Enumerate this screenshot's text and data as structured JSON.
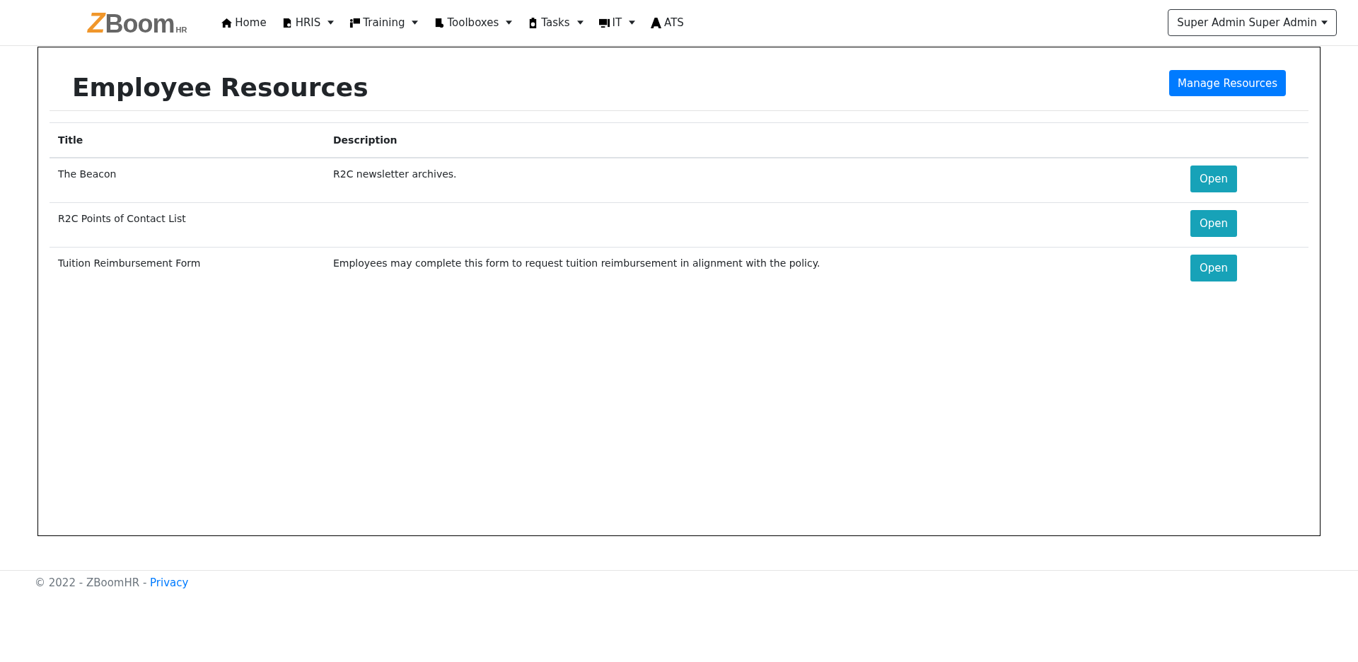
{
  "brand": {
    "mark": "Z",
    "name": "Boom",
    "suffix": "HR"
  },
  "nav": [
    {
      "label": "Home",
      "dropdown": false
    },
    {
      "label": "HRIS",
      "dropdown": true
    },
    {
      "label": "Training",
      "dropdown": true
    },
    {
      "label": "Toolboxes",
      "dropdown": true
    },
    {
      "label": "Tasks",
      "dropdown": true
    },
    {
      "label": "IT",
      "dropdown": true
    },
    {
      "label": "ATS",
      "dropdown": false
    }
  ],
  "user_menu": {
    "label": "Super Admin Super Admin"
  },
  "page": {
    "title": "Employee Resources",
    "action": "Manage Resources"
  },
  "table": {
    "columns": [
      "Title",
      "Description"
    ],
    "rows": [
      {
        "title": "The Beacon",
        "description": "R2C newsletter archives.",
        "action": "Open"
      },
      {
        "title": "R2C Points of Contact List",
        "description": "",
        "action": "Open"
      },
      {
        "title": "Tuition Reimbursement Form",
        "description": "Employees may complete this form to request tuition reimbursement in alignment with the policy.",
        "action": "Open"
      }
    ]
  },
  "footer": {
    "text": "© 2022 - ZBoomHR - ",
    "link": "Privacy"
  }
}
